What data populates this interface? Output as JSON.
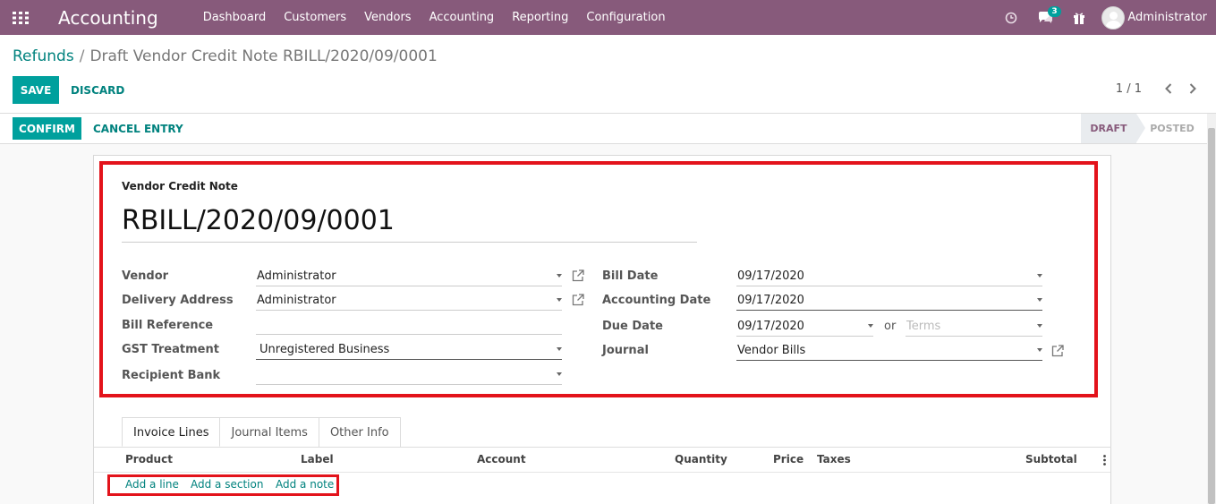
{
  "navbar": {
    "app_title": "Accounting",
    "menu": [
      "Dashboard",
      "Customers",
      "Vendors",
      "Accounting",
      "Reporting",
      "Configuration"
    ],
    "messages_badge": "3",
    "user_name": "Administrator",
    "bg_color": "#875a7b"
  },
  "breadcrumb": {
    "parent": "Refunds",
    "separator": "/",
    "current": "Draft Vendor Credit Note RBILL/2020/09/0001"
  },
  "buttons": {
    "save": "SAVE",
    "discard": "DISCARD",
    "confirm": "CONFIRM",
    "cancel_entry": "CANCEL ENTRY"
  },
  "pager": {
    "value": "1 / 1"
  },
  "status": {
    "draft": "DRAFT",
    "posted": "POSTED"
  },
  "form": {
    "doc_type": "Vendor Credit Note",
    "doc_number": "RBILL/2020/09/0001",
    "labels": {
      "vendor": "Vendor",
      "delivery_address": "Delivery Address",
      "bill_reference": "Bill Reference",
      "gst_treatment": "GST Treatment",
      "recipient_bank": "Recipient Bank",
      "bill_date": "Bill Date",
      "accounting_date": "Accounting Date",
      "due_date": "Due Date",
      "journal": "Journal"
    },
    "values": {
      "vendor": "Administrator",
      "delivery_address": "Administrator",
      "bill_reference": "",
      "gst_treatment": "Unregistered Business",
      "recipient_bank": "",
      "bill_date": "09/17/2020",
      "accounting_date": "09/17/2020",
      "due_date": "09/17/2020",
      "journal": "Vendor Bills"
    },
    "or_text": "or",
    "terms_placeholder": "Terms"
  },
  "tabs": [
    "Invoice Lines",
    "Journal Items",
    "Other Info"
  ],
  "table": {
    "columns": {
      "product": "Product",
      "label": "Label",
      "account": "Account",
      "quantity": "Quantity",
      "price": "Price",
      "taxes": "Taxes",
      "subtotal": "Subtotal"
    },
    "add_line": "Add a line",
    "add_section": "Add a section",
    "add_note": "Add a note"
  },
  "colors": {
    "accent": "#00a09d",
    "link": "#00827e",
    "highlight": "#e3131b"
  }
}
